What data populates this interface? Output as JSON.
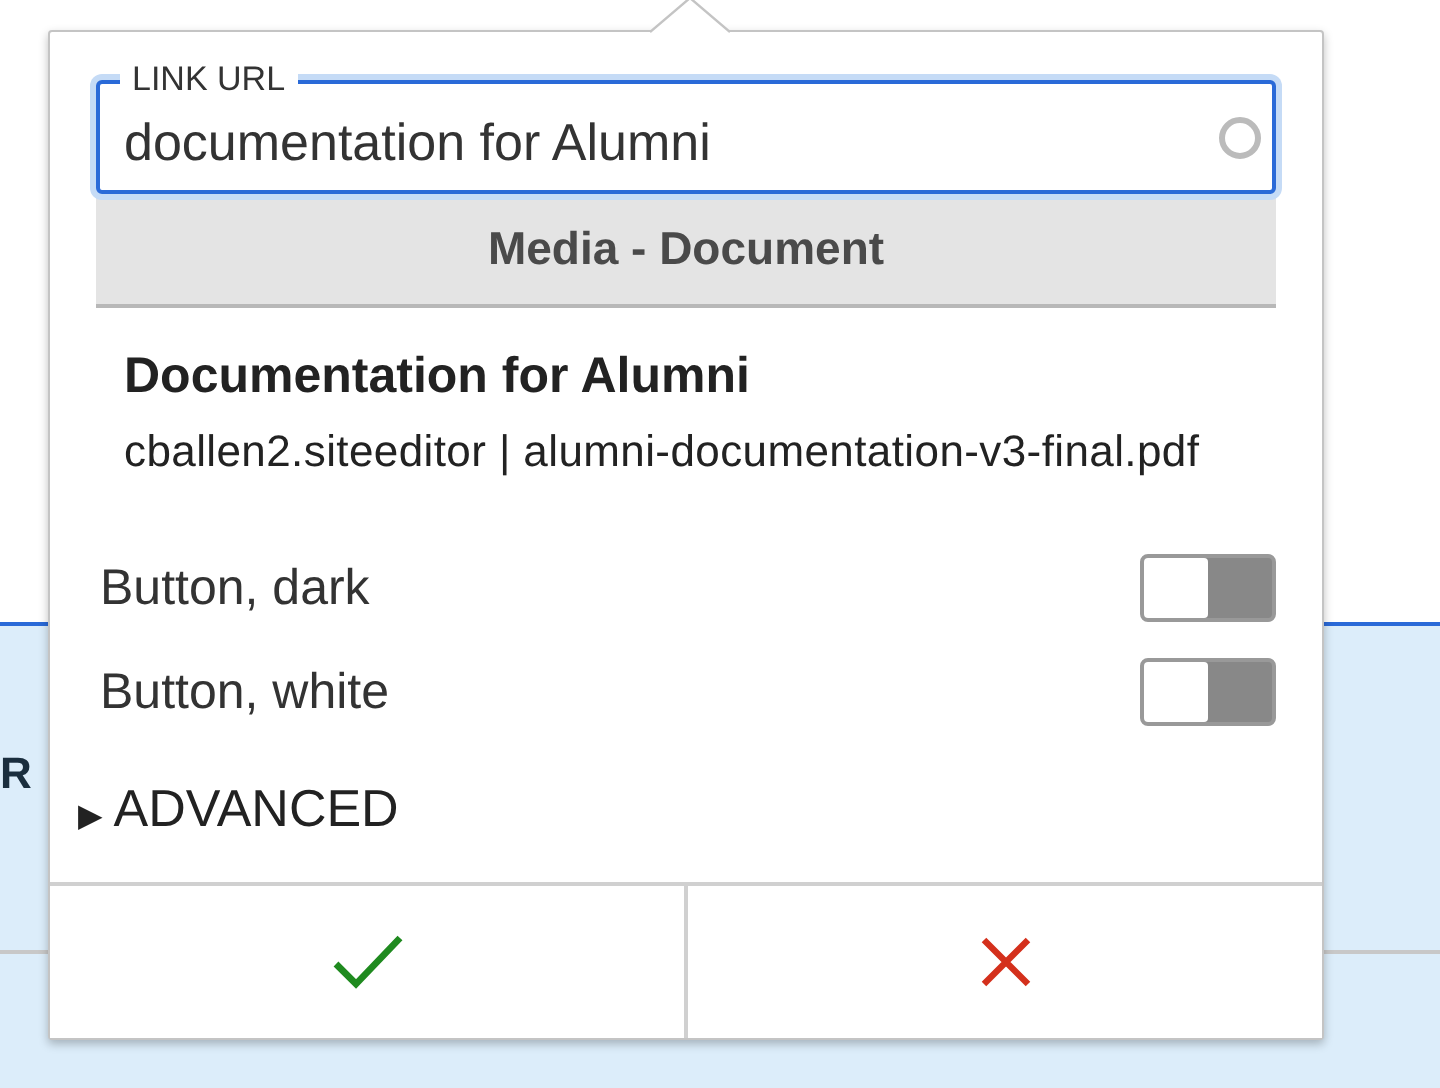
{
  "background": {
    "label": "R"
  },
  "link_field": {
    "label": "LINK URL",
    "value": "documentation for Alumni",
    "loading": true
  },
  "results": {
    "heading": "Media - Document",
    "items": [
      {
        "title": "Documentation for Alumni",
        "detail": "cballen2.siteeditor | alumni-documentation-v3-final.pdf"
      }
    ]
  },
  "options": [
    {
      "label": "Button, dark",
      "on": false
    },
    {
      "label": "Button, white",
      "on": false
    }
  ],
  "advanced": {
    "label": "ADVANCED",
    "expanded": false,
    "arrow": "▶"
  }
}
